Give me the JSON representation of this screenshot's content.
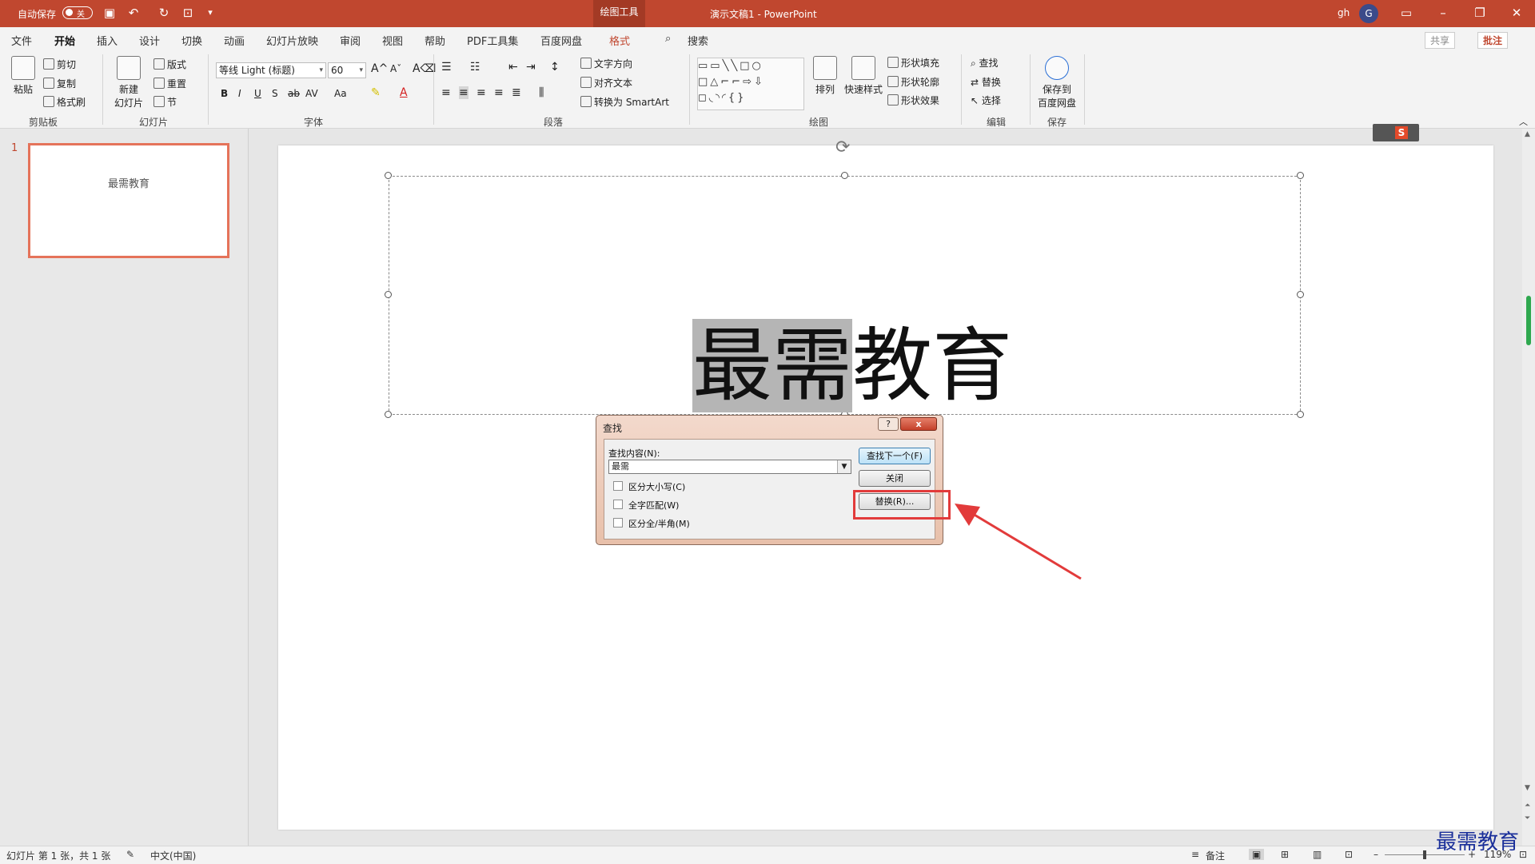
{
  "titlebar": {
    "autosave_label": "自动保存",
    "autosave_state": "关",
    "context_tab": "绘图工具",
    "doc_title": "演示文稿1 - PowerPoint",
    "user": "gh",
    "avatar_letter": "G"
  },
  "tabs": [
    {
      "label": "文件"
    },
    {
      "label": "开始"
    },
    {
      "label": "插入"
    },
    {
      "label": "设计"
    },
    {
      "label": "切换"
    },
    {
      "label": "动画"
    },
    {
      "label": "幻灯片放映"
    },
    {
      "label": "审阅"
    },
    {
      "label": "视图"
    },
    {
      "label": "帮助"
    },
    {
      "label": "PDF工具集"
    },
    {
      "label": "百度网盘"
    },
    {
      "label": "格式"
    }
  ],
  "search_label": "搜索",
  "share_label": "共享",
  "comments_label": "批注",
  "ribbon": {
    "clipboard": {
      "paste": "粘贴",
      "cut": "剪切",
      "copy": "复制",
      "format_painter": "格式刷",
      "label": "剪贴板"
    },
    "slides": {
      "new_slide_1": "新建",
      "new_slide_2": "幻灯片",
      "layout": "版式",
      "reset": "重置",
      "section": "节",
      "label": "幻灯片"
    },
    "font": {
      "name": "等线 Light (标题)",
      "size": "60",
      "label": "字体"
    },
    "paragraph": {
      "text_direction": "文字方向",
      "align_text": "对齐文本",
      "smartart": "转换为 SmartArt",
      "label": "段落"
    },
    "drawing": {
      "arrange": "排列",
      "quick_styles": "快速样式",
      "shape_fill": "形状填充",
      "shape_outline": "形状轮廓",
      "shape_effects": "形状效果",
      "label": "绘图"
    },
    "editing": {
      "find": "查找",
      "replace": "替换",
      "select": "选择",
      "label": "编辑"
    },
    "save": {
      "btn_1": "保存到",
      "btn_2": "百度网盘",
      "label": "保存"
    }
  },
  "thumbnail": {
    "number": "1",
    "text": "最需教育"
  },
  "slide": {
    "highlighted": "最需",
    "rest": "教育"
  },
  "find_dialog": {
    "title": "查找",
    "help": "?",
    "close_x": "x",
    "find_what_label": "查找内容(N):",
    "find_value": "最需",
    "match_case": "区分大小写(C)",
    "whole_word": "全字匹配(W)",
    "half_full": "区分全/半角(M)",
    "find_next": "查找下一个(F)",
    "close": "关闭",
    "replace": "替换(R)..."
  },
  "statusbar": {
    "slide_info": "幻灯片 第 1 张，共 1 张",
    "language": "中文(中国)",
    "notes": "备注",
    "zoom": "119%"
  },
  "watermark": "最需教育"
}
